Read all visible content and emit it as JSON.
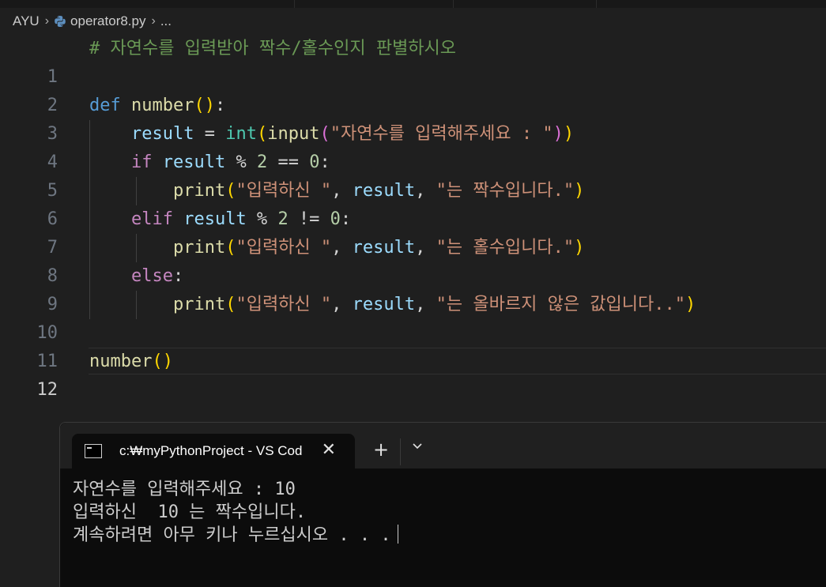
{
  "breadcrumb": {
    "folder": "AYU",
    "file": "operator8.py",
    "more": "..."
  },
  "editor": {
    "active_line": 12,
    "line_numbers": [
      "1",
      "2",
      "3",
      "4",
      "5",
      "6",
      "7",
      "8",
      "9",
      "10",
      "11",
      "12"
    ],
    "lines": {
      "l1": {
        "comment": "# 자연수를 입력받아 짝수/홀수인지 판별하시오"
      },
      "l3": {
        "def": "def",
        "name": "number",
        "paren_open": "(",
        "paren_close": ")",
        "colon": ":"
      },
      "l4": {
        "var": "result",
        "eq": " = ",
        "int": "int",
        "p_open": "(",
        "input": "input",
        "p2_open": "(",
        "str": "\"자연수를 입력해주세요 : \"",
        "p2_close": ")",
        "p_close": ")"
      },
      "l5": {
        "kw": "if",
        "var": " result",
        "op1": " % ",
        "n1": "2",
        "op2": " == ",
        "n2": "0",
        "colon": ":"
      },
      "l6": {
        "fn": "print",
        "p_open": "(",
        "s1": "\"입력하신 \"",
        "c1": ", ",
        "var": "result",
        "c2": ", ",
        "s2": "\"는 짝수입니다.\"",
        "p_close": ")"
      },
      "l7": {
        "kw": "elif",
        "var": " result",
        "op1": " % ",
        "n1": "2",
        "op2": " != ",
        "n2": "0",
        "colon": ":"
      },
      "l8": {
        "fn": "print",
        "p_open": "(",
        "s1": "\"입력하신 \"",
        "c1": ", ",
        "var": "result",
        "c2": ", ",
        "s2": "\"는 홀수입니다.\"",
        "p_close": ")"
      },
      "l9": {
        "kw": "else",
        "colon": ":"
      },
      "l10": {
        "fn": "print",
        "p_open": "(",
        "s1": "\"입력하신 \"",
        "c1": ", ",
        "var": "result",
        "c2": ", ",
        "s2": "\"는 올바르지 않은 값입니다..\"",
        "p_close": ")"
      },
      "l12": {
        "fn": "number",
        "p_open": "(",
        "p_close": ")"
      }
    }
  },
  "terminal": {
    "tab_title": "c:₩myPythonProject - VS Cod",
    "close_icon": "✕",
    "new_tab_icon": "+",
    "output": [
      "자연수를 입력해주세요 : 10",
      "입력하신  10 는 짝수입니다.",
      "계속하려면 아무 키나 누르십시오 . . ."
    ]
  },
  "icons": [
    "python-file-icon",
    "chevron-right-icon",
    "terminal-cmd-icon",
    "close-icon",
    "plus-icon",
    "chevron-down-icon"
  ]
}
